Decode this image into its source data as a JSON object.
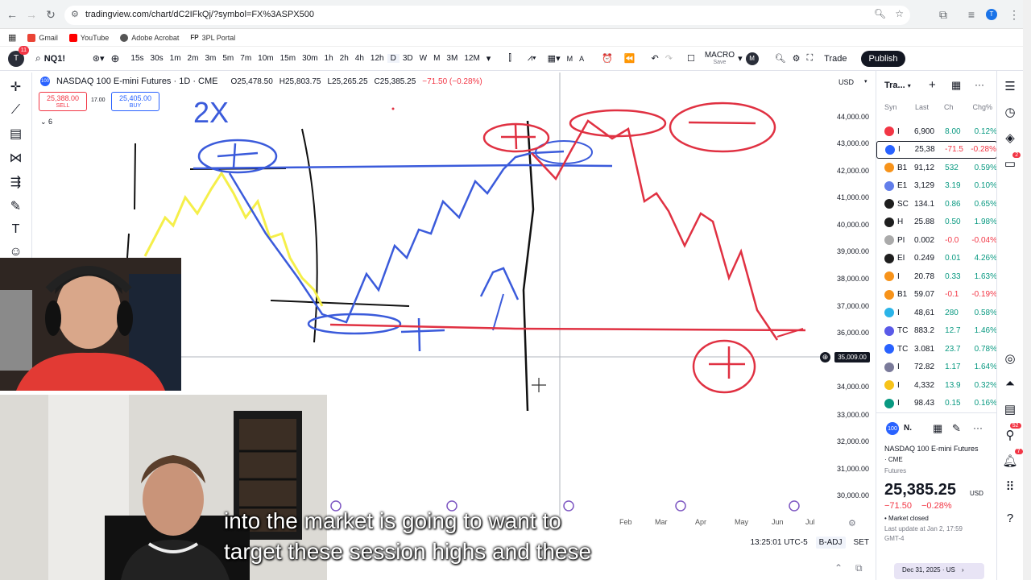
{
  "browser": {
    "url": "tradingview.com/chart/dC2IFkQj/?symbol=FX%3ASPX500",
    "bookmarks": [
      "Gmail",
      "YouTube",
      "Adobe Acrobat",
      "3PL Portal"
    ],
    "bookmark_prefix": "FP",
    "profile_initial": "T"
  },
  "toolbar": {
    "avatar_initial": "T",
    "avatar_badge": "11",
    "symbol": "NQ1!",
    "intervals": [
      "15s",
      "30s",
      "1m",
      "2m",
      "3m",
      "5m",
      "7m",
      "10m",
      "15m",
      "30m",
      "1h",
      "2h",
      "4h",
      "12h",
      "D",
      "3D",
      "W",
      "M",
      "3M",
      "12M"
    ],
    "m_letter": "M",
    "a_letter": "A",
    "macro_label": "MACRO",
    "macro_sub": "Save",
    "macro_initial": "M",
    "trade": "Trade",
    "publish": "Publish"
  },
  "chart": {
    "title": "NASDAQ 100 E-mini Futures · 1D · CME",
    "open": "O25,478.50",
    "high": "H25,803.75",
    "low": "L25,265.25",
    "close": "C25,385.25",
    "change": "−71.50 (−0.28%)",
    "sell_price": "25,388.00",
    "sell_label": "SELL",
    "spread": "17.00",
    "buy_price": "25,405.00",
    "buy_label": "BUY",
    "indicator_count": "6",
    "currency": "USD",
    "price_levels": [
      "44,000.00",
      "43,000.00",
      "42,000.00",
      "41,000.00",
      "40,000.00",
      "39,000.00",
      "38,000.00",
      "37,000.00",
      "36,000.00",
      "34,000.00",
      "33,000.00",
      "32,000.00",
      "31,000.00",
      "30,000.00"
    ],
    "crosshair_price": "35,009.00",
    "time_labels": [
      "Feb",
      "Mar",
      "Apr",
      "May",
      "Jun",
      "Jul"
    ],
    "clock": "13:25:01 UTC-5",
    "badj": "B-ADJ",
    "set": "SET",
    "drawing_text": "2X"
  },
  "watchlist": {
    "title": "Tra...",
    "headers": [
      "Syn",
      "Last",
      "Ch",
      "Chg%"
    ],
    "rows": [
      {
        "sym": "I",
        "last": "6,900",
        "ch": "8.00",
        "chg": "0.12%",
        "color": "#f23645",
        "dir": "pos"
      },
      {
        "sym": "I",
        "last": "25,38",
        "ch": "-71.5",
        "chg": "-0.28%",
        "color": "#2962ff",
        "dir": "neg"
      },
      {
        "sym": "B1",
        "last": "91,12",
        "ch": "532",
        "chg": "0.59%",
        "color": "#f7931a",
        "dir": "pos"
      },
      {
        "sym": "E1",
        "last": "3,129",
        "ch": "3.19",
        "chg": "0.10%",
        "color": "#627eea",
        "dir": "pos"
      },
      {
        "sym": "SC",
        "last": "134.1",
        "ch": "0.86",
        "chg": "0.65%",
        "color": "#1e1e1e",
        "dir": "pos"
      },
      {
        "sym": "H",
        "last": "25.88",
        "ch": "0.50",
        "chg": "1.98%",
        "color": "#1e1e1e",
        "dir": "pos"
      },
      {
        "sym": "PI",
        "last": "0.002",
        "ch": "-0.0",
        "chg": "-0.04%",
        "color": "#aaaaaa",
        "dir": "neg"
      },
      {
        "sym": "EI",
        "last": "0.249",
        "ch": "0.01",
        "chg": "4.26%",
        "color": "#1e1e1e",
        "dir": "pos"
      },
      {
        "sym": "I",
        "last": "20.78",
        "ch": "0.33",
        "chg": "1.63%",
        "color": "#f7931a",
        "dir": "pos"
      },
      {
        "sym": "B1",
        "last": "59.07",
        "ch": "-0.1",
        "chg": "-0.19%",
        "color": "#f7931a",
        "dir": "neg"
      },
      {
        "sym": "I",
        "last": "48,61",
        "ch": "280",
        "chg": "0.58%",
        "color": "#2bb4e8",
        "dir": "pos"
      },
      {
        "sym": "TC",
        "last": "883.2",
        "ch": "12.7",
        "chg": "1.46%",
        "color": "#5a5ae8",
        "dir": "pos"
      },
      {
        "sym": "TC",
        "last": "3.081",
        "ch": "23.7",
        "chg": "0.78%",
        "color": "#2962ff",
        "dir": "pos"
      },
      {
        "sym": "I",
        "last": "72.82",
        "ch": "1.17",
        "chg": "1.64%",
        "color": "#7a7a9a",
        "dir": "pos"
      },
      {
        "sym": "I",
        "last": "4,332",
        "ch": "13.9",
        "chg": "0.32%",
        "color": "#f7c31a",
        "dir": "pos"
      },
      {
        "sym": "I",
        "last": "98.43",
        "ch": "0.15",
        "chg": "0.16%",
        "color": "#089981",
        "dir": "pos"
      }
    ],
    "detail_symbol": "N.",
    "detail_name": "NASDAQ 100 E-mini Futures",
    "detail_exchange": "· CME",
    "detail_type": "Futures",
    "detail_price": "25,385.25",
    "detail_currency": "USD",
    "detail_change": "−71.50",
    "detail_change_pct": "−0.28%",
    "market_status": "Market closed",
    "last_update": "Last update at Jan 2, 17:59",
    "tz": "GMT-4",
    "date_footer": "Dec 31, 2025 · US"
  },
  "sidebar_badges": {
    "alerts": "2",
    "chat": "52",
    "notifications": "7"
  },
  "captions": {
    "line1": "into the market is going to want to",
    "line2": "target these session highs and these"
  }
}
